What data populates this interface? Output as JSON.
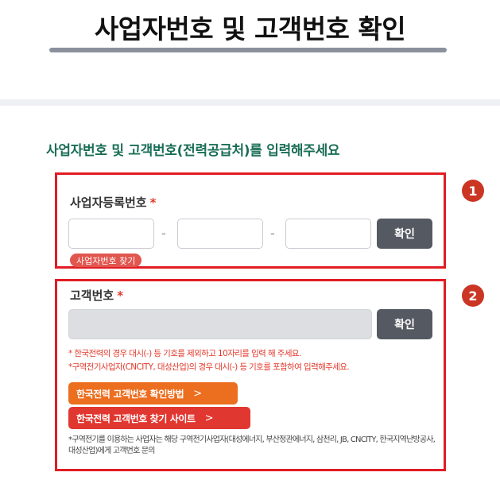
{
  "header": {
    "title": "사업자번호 및 고객번호 확인"
  },
  "instruction": "사업자번호 및 고객번호(전력공급처)를 입력해주세요",
  "business_section": {
    "badge": "1",
    "label": "사업자등록번호",
    "required_mark": "*",
    "inputs": [
      {
        "value": "",
        "placeholder": ""
      },
      {
        "value": "",
        "placeholder": ""
      },
      {
        "value": "",
        "placeholder": ""
      }
    ],
    "separator": "-",
    "confirm_label": "확인",
    "find_link": "사업자번호 찾기"
  },
  "customer_section": {
    "badge": "2",
    "label": "고객번호",
    "required_mark": "*",
    "input": {
      "value": "",
      "placeholder": ""
    },
    "confirm_label": "확인",
    "note1_prefix": "* 한국전력의 경우 ",
    "note1_highlight": "대시(-) 등 기호를 제외하고 10자리를 입력",
    "note1_suffix": " 해 주세요.",
    "note2": "*구역전기사업자(CNCITY, 대성산업)의 경우 대시(-) 등 기호를 포함하여 입력해주세요.",
    "btn_kepco_check": "한국전력 고객번호 확인방법",
    "btn_kepco_find": "한국전력 고객번호 찾기 사이트",
    "chevron": ">",
    "footnote": "*구역전기를 이용하는 사업자는 해당 구역전기사업자(대성에너지, 부산정관에너지, 삼천리, JB, CNCITY, 한국지역난방공사, 대성산업)에게 고객번호 문의"
  },
  "colors": {
    "section_border": "#e11c24",
    "badge": "#cb3524",
    "instruction_text": "#1a6e56",
    "confirm_button": "#555962",
    "orange_button": "#ec6e1f",
    "red_button": "#e03730",
    "required_mark": "#e2392b"
  },
  "icons": {
    "chevron": "chevron-right-icon"
  }
}
